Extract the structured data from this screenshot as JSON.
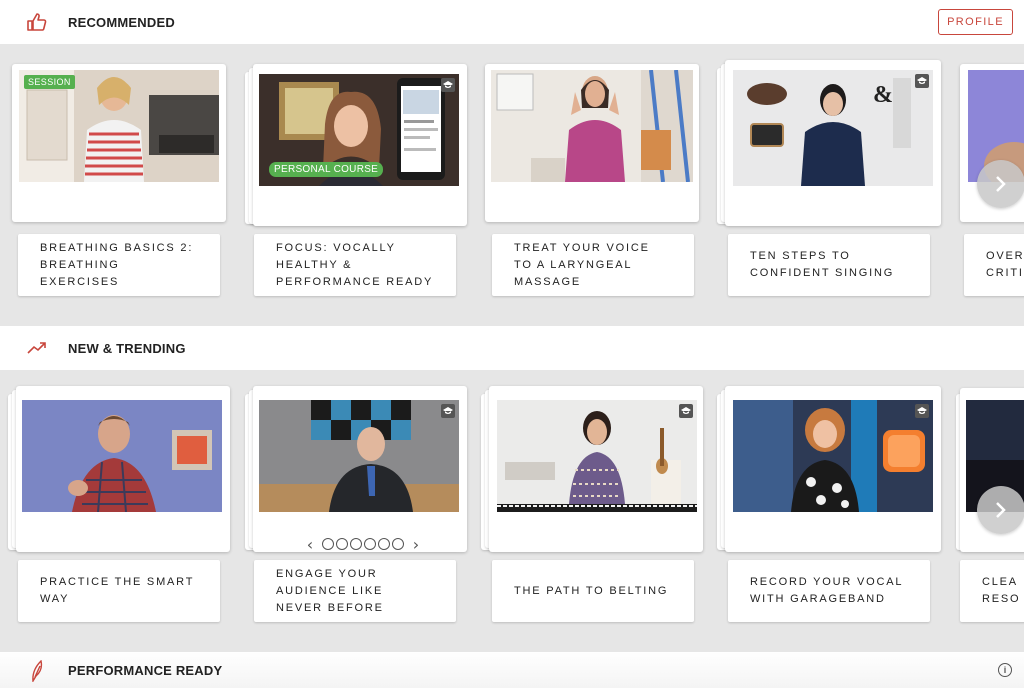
{
  "header": {
    "recommended_title": "RECOMMENDED",
    "profile_label": "PROFILE",
    "new_trending_title": "NEW & TRENDING",
    "performance_ready_title": "PERFORMANCE READY"
  },
  "icons": {
    "recommended": "thumbs-up-icon",
    "trending": "trending-up-icon",
    "performance": "feather-icon",
    "info": "info-icon",
    "next": "chevron-right-icon",
    "course": "graduation-cap-icon"
  },
  "colors": {
    "accent": "#c8463c",
    "badge_green": "#56b04f",
    "background": "#e6e6e6"
  },
  "recommended": [
    {
      "title": "BREATHING BASICS 2: BREATHING EXERCISES",
      "badge": "SESSION"
    },
    {
      "title": "FOCUS: VOCALLY HEALTHY & PERFORMANCE READY",
      "badge": "PERSONAL COURSE"
    },
    {
      "title": "TREAT YOUR VOICE TO A LARYNGEAL MASSAGE"
    },
    {
      "title": "TEN STEPS TO CONFIDENT SINGING"
    },
    {
      "title": "OVER CRITI"
    }
  ],
  "new_trending": [
    {
      "title": "PRACTICE THE SMART WAY"
    },
    {
      "title": "ENGAGE YOUR AUDIENCE LIKE NEVER BEFORE"
    },
    {
      "title": "THE PATH TO BELTING"
    },
    {
      "title": "RECORD YOUR VOCAL WITH GARAGEBAND"
    },
    {
      "title": "CLEA RESO"
    }
  ]
}
